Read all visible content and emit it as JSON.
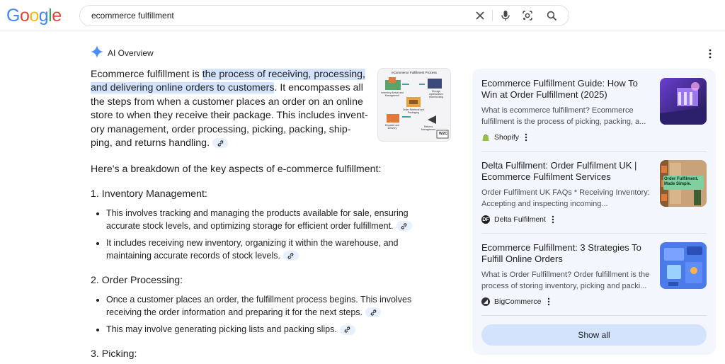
{
  "header": {
    "logo_letters": [
      "G",
      "o",
      "o",
      "g",
      "l",
      "e"
    ],
    "logo_colors": [
      "#4285f4",
      "#ea4335",
      "#fbbc05",
      "#4285f4",
      "#34a853",
      "#ea4335"
    ],
    "search_value": "ecommerce fulfillment"
  },
  "ai_overview": {
    "label": "AI Overview",
    "intro_prefix": "Ecommerce fulfillment is ",
    "intro_highlight": "the process of receiving, processing, and delivering online orders to customers",
    "intro_rest": ". It encompasses all the steps from when a customer places an order on an online store to when they receive their package. This includes invent-ory management, order processing, picking, packing, ship-ping, and returns handling.",
    "thumb": {
      "title": "eCommerce Fulfillment Process",
      "labels": [
        "Inventory Arrival and Management",
        "Storage Optimization Warehousing",
        "Order Retrieval and Packaging",
        "Dispatch and Delivery",
        "Returns Management"
      ],
      "badge": "W2C"
    },
    "breakdown_intro": "Here's a breakdown of the key aspects of e-commerce fulfillment:",
    "sections": [
      {
        "title": "1. Inventory Management:",
        "bullets": [
          "This involves tracking and managing the products available for sale, ensuring accurate stock levels, and optimizing storage for efficient order fulfillment.",
          "It includes receiving new inventory, organizing it within the warehouse, and maintaining accurate records of stock levels."
        ]
      },
      {
        "title": "2. Order Processing:",
        "bullets": [
          "Once a customer places an order, the fulfillment process begins. This involves receiving the order information and preparing it for the next steps.",
          "This may involve generating picking lists and packing slips."
        ]
      },
      {
        "title": "3. Picking:",
        "bullets": []
      }
    ]
  },
  "sources": {
    "cards": [
      {
        "title": "Ecommerce Fulfillment Guide: How To Win at Order Fulfillment (2025)",
        "snippet": "What is ecommerce fulfillment? Ecommerce fulfillment is the process of picking, packing, a...",
        "source": "Shopify",
        "fav_color": "#95bf47",
        "fav_letter": ""
      },
      {
        "title": "Delta Fulfilment: Order Fulfilment UK | Ecommerce Fulfilment Services",
        "snippet": "Order Fulfilment UK FAQs * Receiving Inventory: Accepting and inspecting incoming...",
        "source": "Delta Fulfilment",
        "fav_color": "#1f1f1f",
        "fav_letter": "DF",
        "img_text": "Order Fulfilment. Made Simple."
      },
      {
        "title": "Ecommerce Fulfillment: 3 Strategies To Fulfill Online Orders",
        "snippet": "What is Order Fulfillment? Order fulfillment is the process of storing inventory, picking and packi...",
        "source": "BigCommerce",
        "fav_color": "#34313f",
        "fav_letter": ""
      }
    ],
    "show_all": "Show all"
  }
}
